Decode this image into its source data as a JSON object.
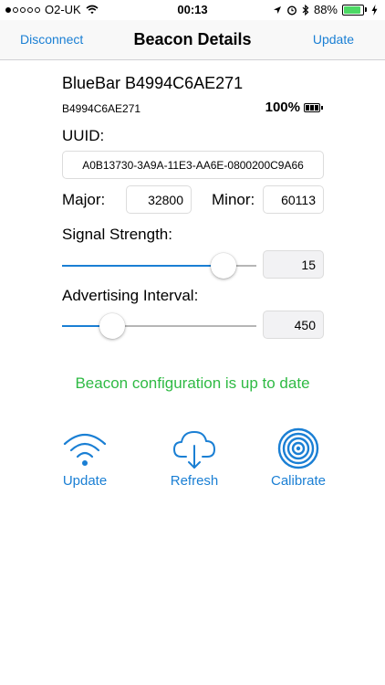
{
  "status_bar": {
    "carrier": "O2-UK",
    "signal_dots_filled": 1,
    "signal_dots_total": 5,
    "time": "00:13",
    "battery_percent": "88%",
    "battery_level": 0.88
  },
  "nav": {
    "left_label": "Disconnect",
    "title": "Beacon Details",
    "right_label": "Update"
  },
  "beacon": {
    "name": "BlueBar B4994C6AE271",
    "id": "B4994C6AE271",
    "battery": "100%"
  },
  "uuid": {
    "label": "UUID:",
    "value": "A0B13730-3A9A-11E3-AA6E-0800200C9A66"
  },
  "major": {
    "label": "Major:",
    "value": "32800"
  },
  "minor": {
    "label": "Minor:",
    "value": "60113"
  },
  "signal_strength": {
    "label": "Signal Strength:",
    "value": "15",
    "level": 0.88
  },
  "advertising_interval": {
    "label": "Advertising Interval:",
    "value": "450",
    "level": 0.22
  },
  "status_message": "Beacon configuration is up to date",
  "colors": {
    "accent": "#1a7fd4",
    "success": "#2fba44",
    "battery_fill": "#4cd964"
  },
  "actions": [
    {
      "label": "Update",
      "icon": "wifi-icon"
    },
    {
      "label": "Refresh",
      "icon": "cloud-download-icon"
    },
    {
      "label": "Calibrate",
      "icon": "target-icon"
    }
  ]
}
